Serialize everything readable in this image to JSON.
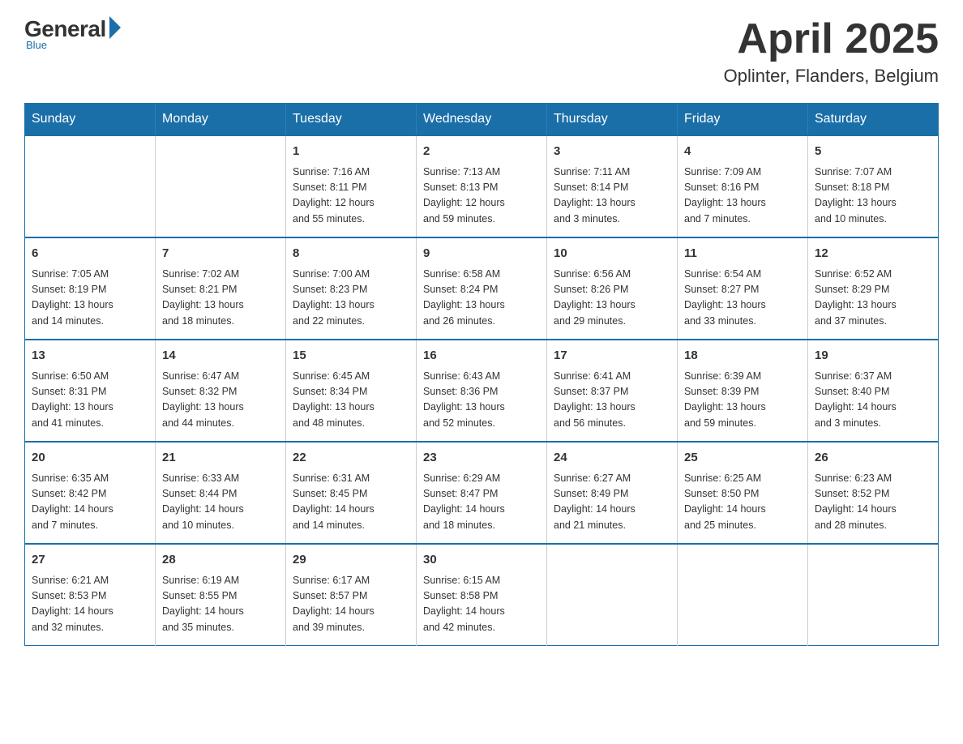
{
  "logo": {
    "general": "General",
    "blue": "Blue",
    "subtitle": "Blue"
  },
  "header": {
    "month": "April 2025",
    "location": "Oplinter, Flanders, Belgium"
  },
  "weekdays": [
    "Sunday",
    "Monday",
    "Tuesday",
    "Wednesday",
    "Thursday",
    "Friday",
    "Saturday"
  ],
  "weeks": [
    [
      {
        "day": "",
        "info": ""
      },
      {
        "day": "",
        "info": ""
      },
      {
        "day": "1",
        "info": "Sunrise: 7:16 AM\nSunset: 8:11 PM\nDaylight: 12 hours\nand 55 minutes."
      },
      {
        "day": "2",
        "info": "Sunrise: 7:13 AM\nSunset: 8:13 PM\nDaylight: 12 hours\nand 59 minutes."
      },
      {
        "day": "3",
        "info": "Sunrise: 7:11 AM\nSunset: 8:14 PM\nDaylight: 13 hours\nand 3 minutes."
      },
      {
        "day": "4",
        "info": "Sunrise: 7:09 AM\nSunset: 8:16 PM\nDaylight: 13 hours\nand 7 minutes."
      },
      {
        "day": "5",
        "info": "Sunrise: 7:07 AM\nSunset: 8:18 PM\nDaylight: 13 hours\nand 10 minutes."
      }
    ],
    [
      {
        "day": "6",
        "info": "Sunrise: 7:05 AM\nSunset: 8:19 PM\nDaylight: 13 hours\nand 14 minutes."
      },
      {
        "day": "7",
        "info": "Sunrise: 7:02 AM\nSunset: 8:21 PM\nDaylight: 13 hours\nand 18 minutes."
      },
      {
        "day": "8",
        "info": "Sunrise: 7:00 AM\nSunset: 8:23 PM\nDaylight: 13 hours\nand 22 minutes."
      },
      {
        "day": "9",
        "info": "Sunrise: 6:58 AM\nSunset: 8:24 PM\nDaylight: 13 hours\nand 26 minutes."
      },
      {
        "day": "10",
        "info": "Sunrise: 6:56 AM\nSunset: 8:26 PM\nDaylight: 13 hours\nand 29 minutes."
      },
      {
        "day": "11",
        "info": "Sunrise: 6:54 AM\nSunset: 8:27 PM\nDaylight: 13 hours\nand 33 minutes."
      },
      {
        "day": "12",
        "info": "Sunrise: 6:52 AM\nSunset: 8:29 PM\nDaylight: 13 hours\nand 37 minutes."
      }
    ],
    [
      {
        "day": "13",
        "info": "Sunrise: 6:50 AM\nSunset: 8:31 PM\nDaylight: 13 hours\nand 41 minutes."
      },
      {
        "day": "14",
        "info": "Sunrise: 6:47 AM\nSunset: 8:32 PM\nDaylight: 13 hours\nand 44 minutes."
      },
      {
        "day": "15",
        "info": "Sunrise: 6:45 AM\nSunset: 8:34 PM\nDaylight: 13 hours\nand 48 minutes."
      },
      {
        "day": "16",
        "info": "Sunrise: 6:43 AM\nSunset: 8:36 PM\nDaylight: 13 hours\nand 52 minutes."
      },
      {
        "day": "17",
        "info": "Sunrise: 6:41 AM\nSunset: 8:37 PM\nDaylight: 13 hours\nand 56 minutes."
      },
      {
        "day": "18",
        "info": "Sunrise: 6:39 AM\nSunset: 8:39 PM\nDaylight: 13 hours\nand 59 minutes."
      },
      {
        "day": "19",
        "info": "Sunrise: 6:37 AM\nSunset: 8:40 PM\nDaylight: 14 hours\nand 3 minutes."
      }
    ],
    [
      {
        "day": "20",
        "info": "Sunrise: 6:35 AM\nSunset: 8:42 PM\nDaylight: 14 hours\nand 7 minutes."
      },
      {
        "day": "21",
        "info": "Sunrise: 6:33 AM\nSunset: 8:44 PM\nDaylight: 14 hours\nand 10 minutes."
      },
      {
        "day": "22",
        "info": "Sunrise: 6:31 AM\nSunset: 8:45 PM\nDaylight: 14 hours\nand 14 minutes."
      },
      {
        "day": "23",
        "info": "Sunrise: 6:29 AM\nSunset: 8:47 PM\nDaylight: 14 hours\nand 18 minutes."
      },
      {
        "day": "24",
        "info": "Sunrise: 6:27 AM\nSunset: 8:49 PM\nDaylight: 14 hours\nand 21 minutes."
      },
      {
        "day": "25",
        "info": "Sunrise: 6:25 AM\nSunset: 8:50 PM\nDaylight: 14 hours\nand 25 minutes."
      },
      {
        "day": "26",
        "info": "Sunrise: 6:23 AM\nSunset: 8:52 PM\nDaylight: 14 hours\nand 28 minutes."
      }
    ],
    [
      {
        "day": "27",
        "info": "Sunrise: 6:21 AM\nSunset: 8:53 PM\nDaylight: 14 hours\nand 32 minutes."
      },
      {
        "day": "28",
        "info": "Sunrise: 6:19 AM\nSunset: 8:55 PM\nDaylight: 14 hours\nand 35 minutes."
      },
      {
        "day": "29",
        "info": "Sunrise: 6:17 AM\nSunset: 8:57 PM\nDaylight: 14 hours\nand 39 minutes."
      },
      {
        "day": "30",
        "info": "Sunrise: 6:15 AM\nSunset: 8:58 PM\nDaylight: 14 hours\nand 42 minutes."
      },
      {
        "day": "",
        "info": ""
      },
      {
        "day": "",
        "info": ""
      },
      {
        "day": "",
        "info": ""
      }
    ]
  ]
}
